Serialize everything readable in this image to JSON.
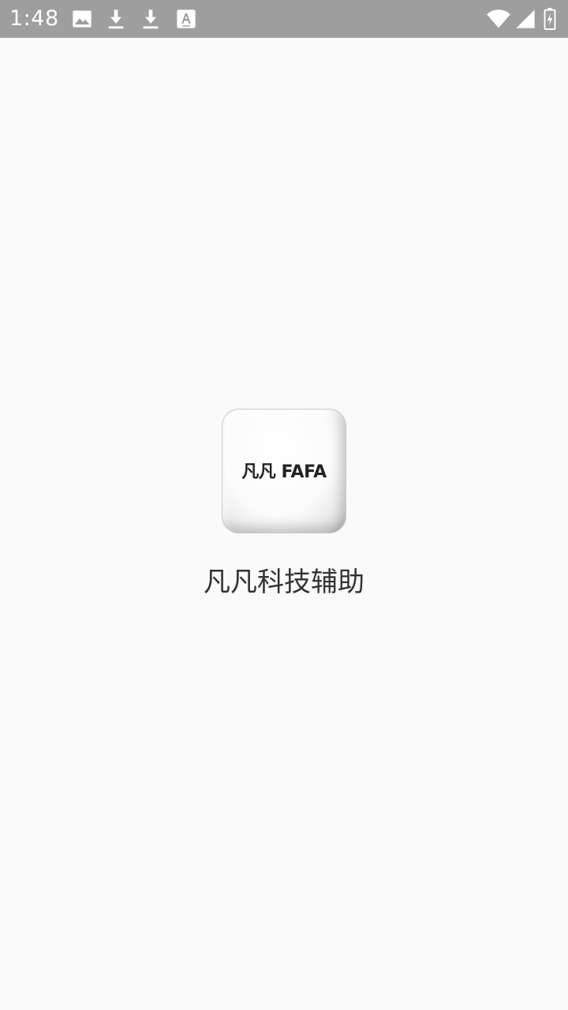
{
  "status_bar": {
    "time": "1:48",
    "left_icons": [
      "image-icon",
      "download-icon",
      "download-icon",
      "font-app-icon"
    ],
    "right_icons": [
      "wifi-icon",
      "cellular-signal-icon",
      "battery-charging-icon"
    ],
    "background_color": "#9e9e9e"
  },
  "splash": {
    "logo_text": "凡凡 FAFA",
    "app_name": "凡凡科技辅助",
    "background_color": "#fafafa"
  }
}
